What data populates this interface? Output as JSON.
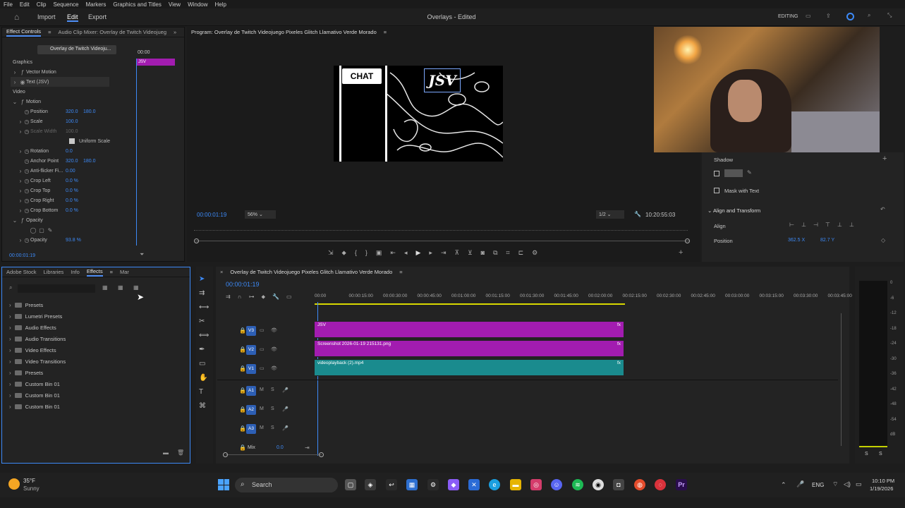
{
  "menu": [
    "File",
    "Edit",
    "Clip",
    "Sequence",
    "Markers",
    "Graphics and Titles",
    "View",
    "Window",
    "Help"
  ],
  "workspace_tabs": {
    "import": "Import",
    "edit": "Edit",
    "export": "Export"
  },
  "project_title": "Overlays - Edited",
  "editing_label": "EDITING",
  "effect_controls": {
    "tab_label": "Effect Controls",
    "mixer_tab": "Audio Clip Mixer: Overlay de Twitch Videojueg",
    "clip_name": "Overlay de Twitch Videoju...",
    "timecode_top": "00:00",
    "clip_mini_label": "JSV",
    "graphics_label": "Graphics",
    "vector_motion": "Vector Motion",
    "text_layer": "Text (JSV)",
    "video_label": "Video",
    "motion": "Motion",
    "position": {
      "label": "Position",
      "x": "320.0",
      "y": "180.0"
    },
    "scale": {
      "label": "Scale",
      "v": "100.0"
    },
    "scale_width": {
      "label": "Scale Width",
      "v": "100.0"
    },
    "uniform_scale": "Uniform Scale",
    "rotation": {
      "label": "Rotation",
      "v": "0.0"
    },
    "anchor": {
      "label": "Anchor Point",
      "x": "320.0",
      "y": "180.0"
    },
    "antiflicker": {
      "label": "Anti-flicker Fi...",
      "v": "0.00"
    },
    "crop_left": {
      "label": "Crop Left",
      "v": "0.0 %"
    },
    "crop_top": {
      "label": "Crop Top",
      "v": "0.0 %"
    },
    "crop_right": {
      "label": "Crop Right",
      "v": "0.0 %"
    },
    "crop_bottom": {
      "label": "Crop Bottom",
      "v": "0.0 %"
    },
    "opacity_group": "Opacity",
    "opacity": {
      "label": "Opacity",
      "v": "93.8 %"
    },
    "timecode_bottom": "00:00:01:19"
  },
  "program": {
    "title": "Program: Overlay de Twitch Videojuego Pixeles Glitch Llamativo Verde Morado",
    "chat_text": "CHAT",
    "jsv_text": "JSV",
    "timecode": "00:00:01:19",
    "zoom": "56%",
    "quality": "1/2",
    "duration": "10:20:55:03"
  },
  "essential_graphics": {
    "shadow": "Shadow",
    "mask_with_text": "Mask with Text",
    "align_transform": "Align and Transform",
    "align": "Align",
    "position_label": "Position",
    "pos_x": "362.5 X",
    "pos_y": "82.7 Y"
  },
  "effects_panel": {
    "tabs": [
      "Adobe Stock",
      "Libraries",
      "Info",
      "Effects",
      "Mar"
    ],
    "items": [
      "Presets",
      "Lumetri Presets",
      "Audio Effects",
      "Audio Transitions",
      "Video Effects",
      "Video Transitions",
      "Presets",
      "Custom Bin 01",
      "Custom Bin 01",
      "Custom Bin 01"
    ]
  },
  "timeline": {
    "sequence_name": "Overlay de Twitch Videojuego Pixeles Glitch Llamativo Verde Morado",
    "timecode": "00:00:01:19",
    "ruler": [
      "00:00",
      "00:00:15:00",
      "00:00:30:00",
      "00:00:45:00",
      "00:01:00:00",
      "00:01:15:00",
      "00:01:30:00",
      "00:01:45:00",
      "00:02:00:00",
      "00:02:15:00",
      "00:02:30:00",
      "00:02:45:00",
      "00:03:00:00",
      "00:03:15:00",
      "00:03:30:00",
      "00:03:45:00"
    ],
    "video_tracks": [
      "V3",
      "V2",
      "V1"
    ],
    "audio_tracks": [
      "A1",
      "A2",
      "A3"
    ],
    "mix_label": "Mix",
    "mix_value": "0.0",
    "clips": {
      "v3": "JSV",
      "v2": "Screenshot 2026-01-19 215131.png",
      "v1": "videoplayback (2).mp4"
    },
    "fx": "fx"
  },
  "meter_labels": [
    "0",
    "-6",
    "-12",
    "-18",
    "-24",
    "-30",
    "-36",
    "-42",
    "-48",
    "-54",
    "dB"
  ],
  "meter_footer": [
    "S",
    "S"
  ],
  "taskbar": {
    "temp": "35°F",
    "weather": "Sunny",
    "search": "Search",
    "lang": "ENG",
    "time": "10:10 PM",
    "date": "1/19/2026"
  },
  "colors": {
    "accent": "#3d8af7",
    "clip_purple": "#a21cb0",
    "clip_teal": "#1a8b8e"
  }
}
